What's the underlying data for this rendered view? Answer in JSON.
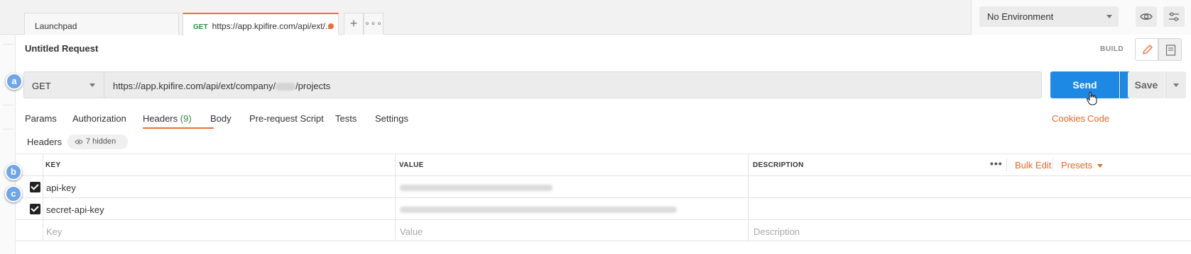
{
  "tabs": {
    "launchpad_label": "Launchpad",
    "active": {
      "method": "GET",
      "label": "https://app.kpifire.com/api/ext/..."
    },
    "new_tab_symbol": "+",
    "more_symbol": "∘∘∘"
  },
  "environment": {
    "selected": "No Environment"
  },
  "request": {
    "title": "Untitled Request",
    "build_label": "BUILD",
    "method": "GET",
    "url_prefix": "https://app.kpifire.com/api/ext/company/",
    "url_suffix": "/projects",
    "send_label": "Send",
    "save_label": "Save"
  },
  "callouts": [
    "a",
    "b",
    "c"
  ],
  "subtabs": [
    {
      "label": "Params"
    },
    {
      "label": "Authorization"
    },
    {
      "label": "Headers",
      "count": "(9)"
    },
    {
      "label": "Body"
    },
    {
      "label": "Pre-request Script"
    },
    {
      "label": "Tests"
    },
    {
      "label": "Settings"
    }
  ],
  "links": {
    "cookies": "Cookies",
    "code": "Code"
  },
  "headers_section": {
    "label": "Headers",
    "hidden_label": "7 hidden"
  },
  "table": {
    "columns": {
      "key": "KEY",
      "value": "VALUE",
      "description": "DESCRIPTION"
    },
    "more_symbol": "•••",
    "bulk_edit": "Bulk Edit",
    "presets": "Presets",
    "rows": [
      {
        "key": "api-key",
        "checked": true
      },
      {
        "key": "secret-api-key",
        "checked": true
      }
    ],
    "placeholders": {
      "key": "Key",
      "value": "Value",
      "description": "Description"
    }
  },
  "colors": {
    "accent_orange": "#f26b3a",
    "send_blue": "#1e88e5",
    "method_green": "#2e8b3e",
    "callout_blue": "#6ea6e8"
  }
}
